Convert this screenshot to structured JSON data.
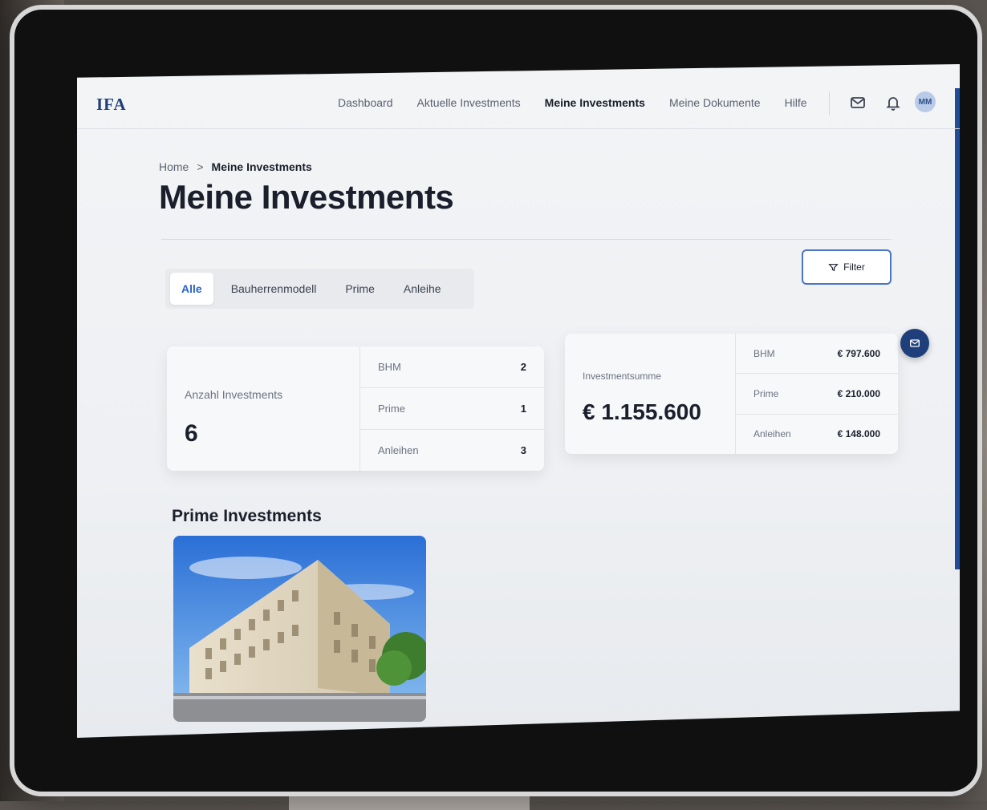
{
  "app": {
    "logo": "IFA"
  },
  "nav": {
    "links": [
      "Dashboard",
      "Aktuelle Investments",
      "Meine Investments",
      "Meine Dokumente",
      "Hilfe"
    ],
    "active_index": 2,
    "icons": [
      "mail-icon",
      "bell-icon"
    ],
    "avatar_initials": "MM"
  },
  "breadcrumb": {
    "home": "Home",
    "separator": ">",
    "current": "Meine Investments"
  },
  "page": {
    "title": "Meine Investments"
  },
  "tabs": {
    "items": [
      "Alle",
      "Bauherrenmodell",
      "Prime",
      "Anleihe"
    ],
    "active_index": 0
  },
  "filter": {
    "label": "Filter",
    "icon": "filter-icon"
  },
  "count_card": {
    "label": "Anzahl Investments",
    "value": "6",
    "rows": [
      {
        "label": "BHM",
        "value": "2"
      },
      {
        "label": "Prime",
        "value": "1"
      },
      {
        "label": "Anleihen",
        "value": "3"
      }
    ]
  },
  "sum_card": {
    "label": "Investmentsumme",
    "value": "€ 1.155.600",
    "rows": [
      {
        "label": "BHM",
        "value": "€ 797.600"
      },
      {
        "label": "Prime",
        "value": "€ 210.000"
      },
      {
        "label": "Anleihen",
        "value": "€ 148.000"
      }
    ]
  },
  "fab": {
    "icon": "mail-icon"
  },
  "section": {
    "title": "Prime Investments"
  },
  "colors": {
    "brand": "#1f3f7a",
    "accent": "#2a62c9",
    "text": "#1a1f2b"
  }
}
